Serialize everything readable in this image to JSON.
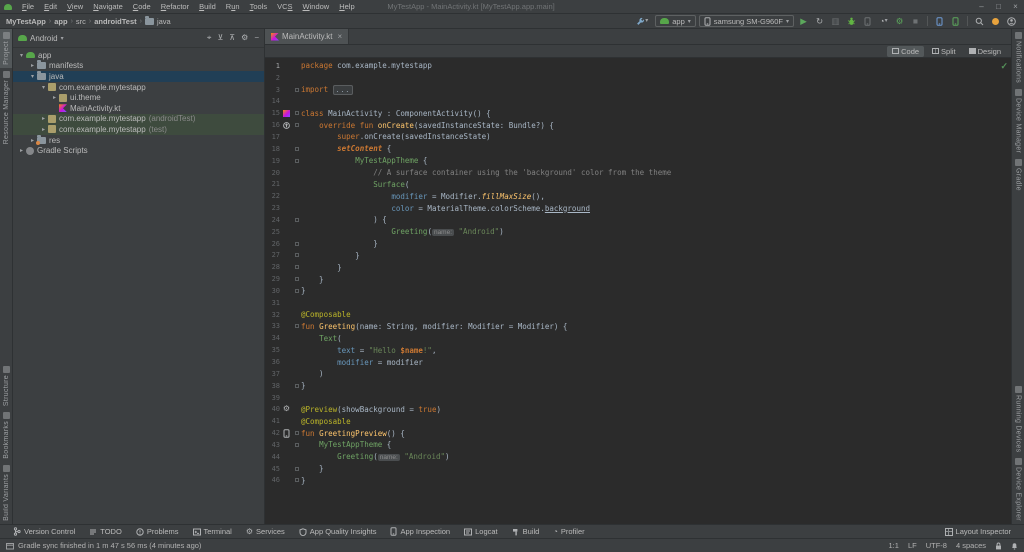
{
  "window": {
    "title": "MyTestApp - MainActivity.kt [MyTestApp.app.main]",
    "controls": [
      {
        "name": "minimize"
      },
      {
        "name": "maximize"
      },
      {
        "name": "close"
      }
    ]
  },
  "menu": {
    "items": [
      {
        "label": "File",
        "m": 0
      },
      {
        "label": "Edit",
        "m": 0
      },
      {
        "label": "View",
        "m": 0
      },
      {
        "label": "Navigate",
        "m": 0
      },
      {
        "label": "Code",
        "m": 0
      },
      {
        "label": "Refactor",
        "m": 0
      },
      {
        "label": "Build",
        "m": 0
      },
      {
        "label": "Run",
        "m": 1
      },
      {
        "label": "Tools",
        "m": 0
      },
      {
        "label": "VCS",
        "m": 2
      },
      {
        "label": "Window",
        "m": 0
      },
      {
        "label": "Help",
        "m": 0
      }
    ]
  },
  "breadcrumbs": [
    {
      "label": "MyTestApp",
      "bold": true
    },
    {
      "label": "app",
      "bold": true
    },
    {
      "label": "src",
      "bold": false
    },
    {
      "label": "androidTest",
      "bold": true
    },
    {
      "label": "java",
      "bold": false,
      "icon": "folder"
    }
  ],
  "toolbar": {
    "wrench": {
      "name": "build-variants-wrench",
      "icon": "wrench",
      "chev": true
    },
    "run_config": {
      "icon": "android-head",
      "label": "app",
      "chev": true
    },
    "device": {
      "icon": "phone-gray",
      "label": "samsung SM-G960F",
      "chev": true
    },
    "actions": [
      {
        "name": "run-button",
        "icon": "play"
      },
      {
        "name": "apply-changes-button",
        "icon": "restart"
      },
      {
        "name": "apply-code-changes-button",
        "icon": "apply-code"
      },
      {
        "name": "debug-button",
        "icon": "bug"
      },
      {
        "name": "attach-debugger-button",
        "icon": "phone-dim"
      },
      {
        "name": "profiler-button",
        "icon": "gauge",
        "chev": true
      },
      {
        "name": "profile-low-overhead-button",
        "icon": "gear-green"
      },
      {
        "name": "stop-button",
        "icon": "stop"
      },
      {
        "type": "sep"
      },
      {
        "name": "device-manager-button",
        "icon": "phone-blue"
      },
      {
        "name": "running-devices-button",
        "icon": "phone-green"
      },
      {
        "type": "sep"
      },
      {
        "name": "search-everywhere-button",
        "icon": "search"
      },
      {
        "name": "sync-status-dot",
        "icon": "dot-orange",
        "color": "#E8A33D"
      },
      {
        "name": "account-avatar",
        "icon": "avatar"
      }
    ]
  },
  "left_stripe": {
    "top": [
      {
        "label": "Project",
        "active": true
      },
      {
        "label": "Resource Manager",
        "active": false
      }
    ],
    "bottom": [
      {
        "label": "Structure",
        "active": false
      },
      {
        "label": "Bookmarks",
        "active": false
      },
      {
        "label": "Build Variants",
        "active": false
      }
    ]
  },
  "right_stripe": {
    "top": [
      {
        "label": "Notifications",
        "active": false
      },
      {
        "label": "Device Manager",
        "active": false
      },
      {
        "label": "Gradle",
        "active": false
      }
    ],
    "bottom": [
      {
        "label": "Running Devices",
        "active": false
      },
      {
        "label": "Device Explorer",
        "active": false
      }
    ]
  },
  "project": {
    "view": "Android",
    "header_actions": [
      {
        "name": "locate-file-button",
        "glyph": "⌖"
      },
      {
        "name": "expand-all-button",
        "glyph": "⊻"
      },
      {
        "name": "collapse-all-button",
        "glyph": "⊼"
      },
      {
        "name": "settings-gear-button",
        "glyph": "⚙"
      },
      {
        "name": "hide-panel-button",
        "glyph": "−"
      }
    ],
    "tree": [
      {
        "label": "app",
        "depth": 0,
        "arrow": "open",
        "icon": "android-head"
      },
      {
        "label": "manifests",
        "depth": 1,
        "arrow": "closed",
        "icon": "folder"
      },
      {
        "label": "java",
        "depth": 1,
        "arrow": "open",
        "icon": "folder",
        "selected": true
      },
      {
        "label": "com.example.mytestapp",
        "depth": 2,
        "arrow": "open",
        "icon": "package"
      },
      {
        "label": "ui.theme",
        "depth": 3,
        "arrow": "closed",
        "icon": "package"
      },
      {
        "label": "MainActivity.kt",
        "depth": 3,
        "arrow": "none",
        "icon": "kotlin"
      },
      {
        "label": "com.example.mytestapp",
        "suffix": "(androidTest)",
        "depth": 2,
        "arrow": "closed",
        "icon": "package",
        "vcs": "green"
      },
      {
        "label": "com.example.mytestapp",
        "suffix": "(test)",
        "depth": 2,
        "arrow": "closed",
        "icon": "package",
        "vcs": "green"
      },
      {
        "label": "res",
        "depth": 1,
        "arrow": "closed",
        "icon": "folder-res"
      },
      {
        "label": "Gradle Scripts",
        "depth": 0,
        "arrow": "closed",
        "icon": "gradle"
      }
    ]
  },
  "editor": {
    "tab": {
      "label": "MainActivity.kt",
      "icon": "kotlin"
    },
    "modes": [
      {
        "label": "Code",
        "active": true
      },
      {
        "label": "Split",
        "active": false
      },
      {
        "label": "Design",
        "active": false
      }
    ],
    "inspection_status": "ok",
    "lines": [
      {
        "n": "1",
        "cur": true,
        "seg": [
          [
            "k",
            "package"
          ],
          [
            "d",
            " com.example.mytestapp"
          ]
        ]
      },
      {
        "n": "2",
        "seg": []
      },
      {
        "n": "3",
        "fm": 1,
        "seg": [
          [
            "k",
            "import"
          ],
          [
            "d",
            " "
          ],
          [
            "fold",
            "..."
          ]
        ]
      },
      {
        "n": "14",
        "seg": []
      },
      {
        "n": "15",
        "g": "class",
        "fm": 1,
        "seg": [
          [
            "k",
            "class"
          ],
          [
            "d",
            " MainActivity : ComponentActivity() {"
          ]
        ]
      },
      {
        "n": "16",
        "g": "override",
        "fm": 1,
        "seg": [
          [
            "d",
            "    "
          ],
          [
            "k",
            "override"
          ],
          [
            "d",
            " "
          ],
          [
            "k",
            "fun"
          ],
          [
            "d",
            " "
          ],
          [
            "f",
            "onCreate"
          ],
          [
            "d",
            "(savedInstanceState: Bundle?) {"
          ]
        ]
      },
      {
        "n": "17",
        "seg": [
          [
            "d",
            "        "
          ],
          [
            "k",
            "super"
          ],
          [
            "d",
            ".onCreate(savedInstanceState)"
          ]
        ]
      },
      {
        "n": "18",
        "fm": 1,
        "seg": [
          [
            "d",
            "        "
          ],
          [
            "i",
            "setContent"
          ],
          [
            "d",
            " {"
          ]
        ]
      },
      {
        "n": "19",
        "fm": 1,
        "seg": [
          [
            "d",
            "            "
          ],
          [
            "c",
            "MyTestAppTheme"
          ],
          [
            "d",
            " {"
          ]
        ]
      },
      {
        "n": "20",
        "seg": [
          [
            "cm",
            "                // A surface container using the 'background' color from the theme"
          ]
        ]
      },
      {
        "n": "21",
        "seg": [
          [
            "d",
            "                "
          ],
          [
            "c",
            "Surface"
          ],
          [
            "d",
            "("
          ]
        ]
      },
      {
        "n": "22",
        "seg": [
          [
            "d",
            "                    "
          ],
          [
            "m",
            "modifier"
          ],
          [
            "d",
            " = Modifier."
          ],
          [
            "y",
            "fillMaxSize"
          ],
          [
            "d",
            "(),"
          ]
        ]
      },
      {
        "n": "23",
        "seg": [
          [
            "d",
            "                    "
          ],
          [
            "m",
            "color"
          ],
          [
            "d",
            " = MaterialTheme.colorScheme."
          ],
          [
            "u",
            "background"
          ]
        ]
      },
      {
        "n": "24",
        "fm": 1,
        "seg": [
          [
            "d",
            "                ) {"
          ]
        ]
      },
      {
        "n": "25",
        "seg": [
          [
            "d",
            "                    "
          ],
          [
            "c",
            "Greeting"
          ],
          [
            "d",
            "("
          ],
          [
            "hint",
            "name:"
          ],
          [
            "d",
            " "
          ],
          [
            "s",
            "\"Android\""
          ],
          [
            "d",
            ")"
          ]
        ]
      },
      {
        "n": "26",
        "fm": 1,
        "seg": [
          [
            "d",
            "                }"
          ]
        ]
      },
      {
        "n": "27",
        "fm": 1,
        "seg": [
          [
            "d",
            "            }"
          ]
        ]
      },
      {
        "n": "28",
        "fm": 1,
        "seg": [
          [
            "d",
            "        }"
          ]
        ]
      },
      {
        "n": "29",
        "fm": 1,
        "seg": [
          [
            "d",
            "    }"
          ]
        ]
      },
      {
        "n": "30",
        "fm": 1,
        "seg": [
          [
            "d",
            "}"
          ]
        ]
      },
      {
        "n": "31",
        "seg": []
      },
      {
        "n": "32",
        "seg": [
          [
            "a",
            "@Composable"
          ]
        ]
      },
      {
        "n": "33",
        "fm": 1,
        "seg": [
          [
            "k",
            "fun"
          ],
          [
            "d",
            " "
          ],
          [
            "f",
            "Greeting"
          ],
          [
            "d",
            "(name: String, modifier: Modifier = Modifier) {"
          ]
        ]
      },
      {
        "n": "34",
        "seg": [
          [
            "d",
            "    "
          ],
          [
            "c",
            "Text"
          ],
          [
            "d",
            "("
          ]
        ]
      },
      {
        "n": "35",
        "seg": [
          [
            "d",
            "        "
          ],
          [
            "m",
            "text"
          ],
          [
            "d",
            " = "
          ],
          [
            "s",
            "\"Hello "
          ],
          [
            "v",
            "$name"
          ],
          [
            "s",
            "!\""
          ],
          [
            "d",
            ","
          ]
        ]
      },
      {
        "n": "36",
        "seg": [
          [
            "d",
            "        "
          ],
          [
            "m",
            "modifier"
          ],
          [
            "d",
            " = modifier"
          ]
        ]
      },
      {
        "n": "37",
        "seg": [
          [
            "d",
            "    )"
          ]
        ]
      },
      {
        "n": "38",
        "fm": 1,
        "seg": [
          [
            "d",
            "}"
          ]
        ]
      },
      {
        "n": "39",
        "seg": []
      },
      {
        "n": "40",
        "g": "gear",
        "seg": [
          [
            "a",
            "@Preview"
          ],
          [
            "d",
            "(showBackground = "
          ],
          [
            "k",
            "true"
          ],
          [
            "d",
            ")"
          ]
        ]
      },
      {
        "n": "41",
        "seg": [
          [
            "a",
            "@Composable"
          ]
        ]
      },
      {
        "n": "42",
        "g": "device",
        "fm": 1,
        "seg": [
          [
            "k",
            "fun"
          ],
          [
            "d",
            " "
          ],
          [
            "f",
            "GreetingPreview"
          ],
          [
            "d",
            "() {"
          ]
        ]
      },
      {
        "n": "43",
        "fm": 1,
        "seg": [
          [
            "d",
            "    "
          ],
          [
            "c",
            "MyTestAppTheme"
          ],
          [
            "d",
            " {"
          ]
        ]
      },
      {
        "n": "44",
        "seg": [
          [
            "d",
            "        "
          ],
          [
            "c",
            "Greeting"
          ],
          [
            "d",
            "("
          ],
          [
            "hint",
            "name:"
          ],
          [
            "d",
            " "
          ],
          [
            "s",
            "\"Android\""
          ],
          [
            "d",
            ")"
          ]
        ]
      },
      {
        "n": "45",
        "fm": 1,
        "seg": [
          [
            "d",
            "    }"
          ]
        ]
      },
      {
        "n": "46",
        "fm": 1,
        "seg": [
          [
            "d",
            "}"
          ]
        ]
      }
    ]
  },
  "bottom_bar": {
    "left": [
      {
        "label": "Version Control",
        "icon": "branch"
      },
      {
        "label": "TODO",
        "icon": "todo"
      },
      {
        "label": "Problems",
        "icon": "problems"
      },
      {
        "label": "Terminal",
        "icon": "terminal"
      },
      {
        "label": "Services",
        "icon": "services"
      },
      {
        "label": "App Quality Insights",
        "icon": "insights"
      },
      {
        "label": "App Inspection",
        "icon": "inspection"
      },
      {
        "label": "Logcat",
        "icon": "logcat"
      },
      {
        "label": "Build",
        "icon": "hammer"
      },
      {
        "label": "Profiler",
        "icon": "gauge"
      }
    ],
    "right": [
      {
        "label": "Layout Inspector",
        "icon": "layout-inspector"
      }
    ]
  },
  "statusbar": {
    "message": "Gradle sync finished in 1 m 47 s 56 ms (4 minutes ago)",
    "message_icon": "window",
    "items": [
      "1:1",
      "LF",
      "UTF-8",
      "4 spaces"
    ],
    "icons": [
      {
        "name": "write-access-lock-icon",
        "icon": "lock"
      },
      {
        "name": "notifications-icon",
        "icon": "bell"
      }
    ]
  },
  "colors": {
    "panel_bg": "#3C3F41",
    "editor_bg": "#2B2B2B",
    "selection_blue": "#213F56",
    "vcs_green_row": "#3E4B3E",
    "keyword": "#CC7832",
    "function_decl": "#FFC66D",
    "composable_call": "#6FA364",
    "named_arg": "#6897BB",
    "string": "#6A8759",
    "comment": "#808080",
    "annotation": "#BBB529",
    "run_green": "#5CA85C",
    "debug_green": "#62B543",
    "sync_orange": "#E8A33D",
    "check_green": "#549159"
  }
}
